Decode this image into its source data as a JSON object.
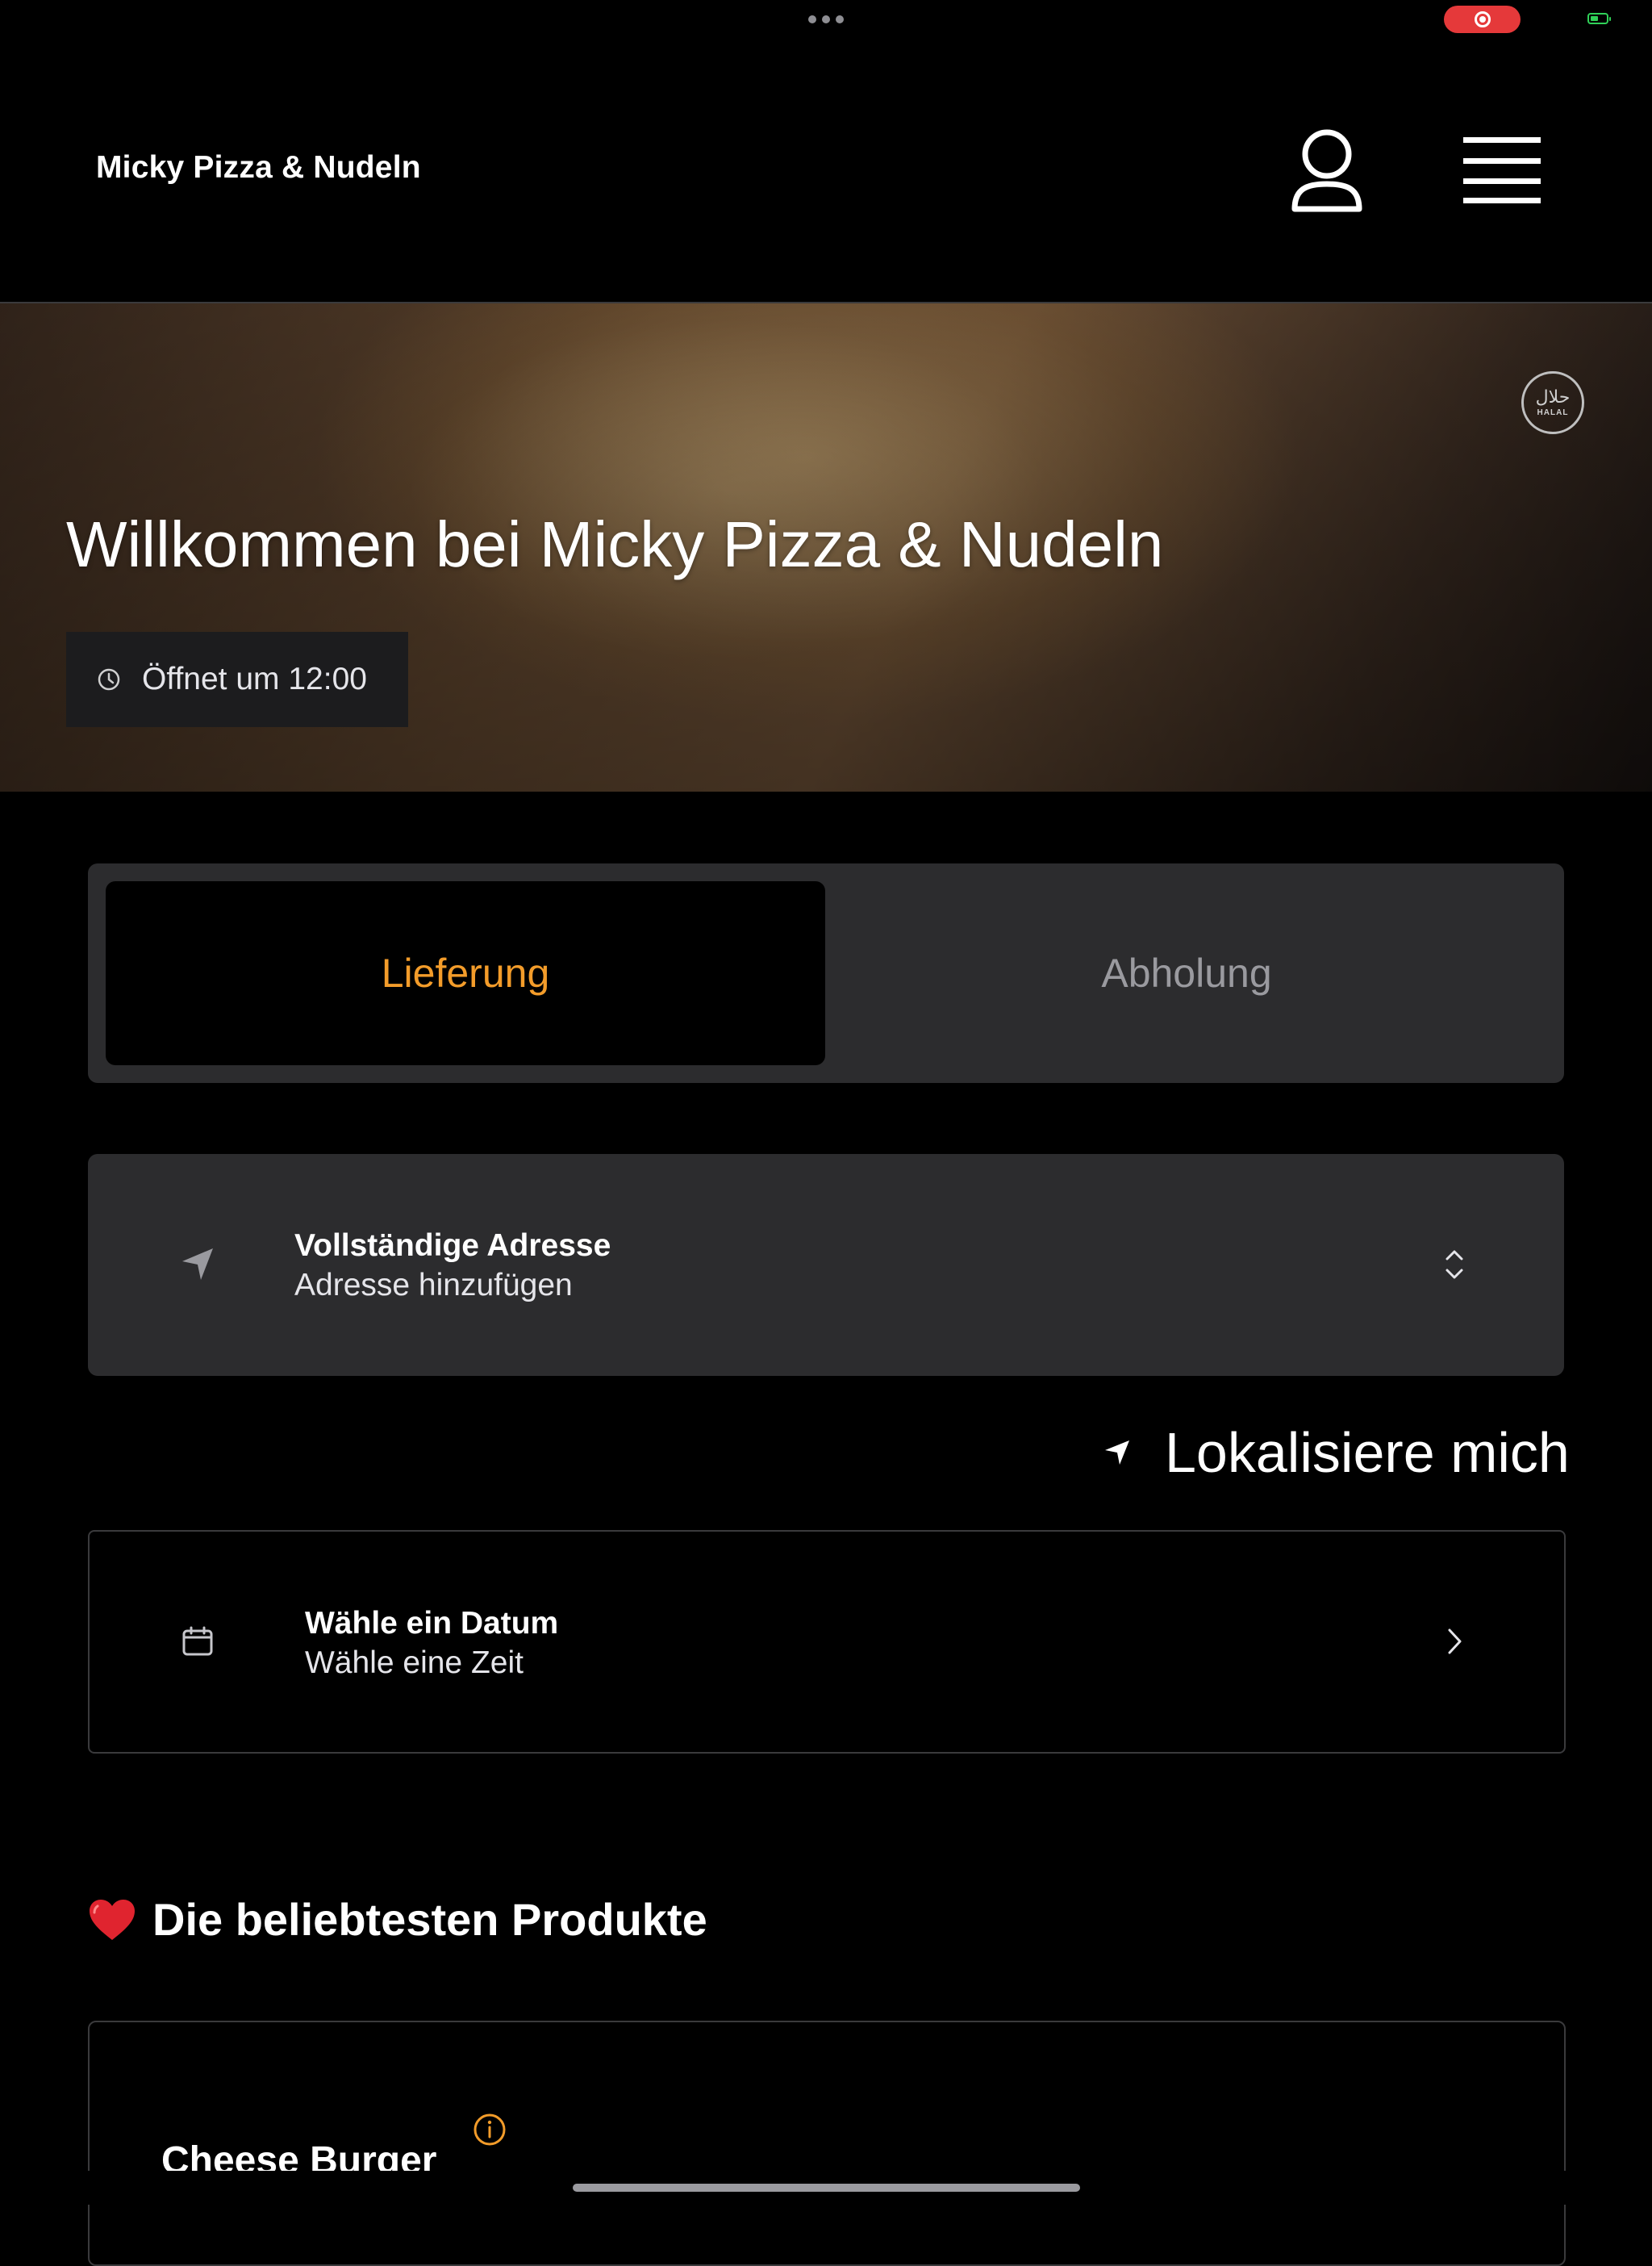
{
  "app": {
    "brand_title": "Micky Pizza & Nudeln"
  },
  "header": {
    "icons": [
      "user-icon",
      "hamburger-menu-icon"
    ]
  },
  "hero": {
    "title": "Willkommen bei Micky Pizza & Nudeln",
    "hours_text": "Öffnet um 12:00",
    "halal_badge_arabic": "حلال",
    "halal_badge_latin": "HALAL"
  },
  "order_mode": {
    "options": [
      "Lieferung",
      "Abholung"
    ],
    "selected": "Lieferung",
    "active_color": "#f39c2a"
  },
  "address": {
    "label": "Vollständige Adresse",
    "value": "Adresse hinzufügen"
  },
  "locate": {
    "label": "Lokalisiere mich"
  },
  "schedule": {
    "date_label": "Wähle ein Datum",
    "time_label": "Wähle eine Zeit"
  },
  "popular": {
    "emoji": "❤️",
    "title": "Die beliebtesten Produkte",
    "products": [
      {
        "name": "Cheese Burger"
      }
    ]
  }
}
